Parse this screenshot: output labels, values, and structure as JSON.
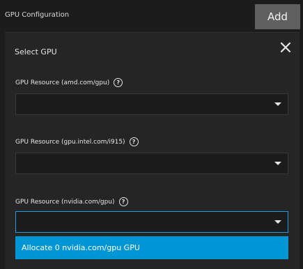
{
  "topbar": {
    "title": "GPU Configuration",
    "add_label": "Add"
  },
  "panel": {
    "title": "Select GPU"
  },
  "fields": [
    {
      "label": "GPU Resource (amd.com/gpu)",
      "help": "?",
      "value": ""
    },
    {
      "label": "GPU Resource (gpu.intel.com/i915)",
      "help": "?",
      "value": ""
    },
    {
      "label": "GPU Resource (nvidia.com/gpu)",
      "help": "?",
      "value": ""
    }
  ],
  "dropdown": {
    "options": [
      "Allocate 0 nvidia.com/gpu GPU"
    ]
  },
  "colors": {
    "accent": "#0095d5",
    "focus_border": "#1e9ce4",
    "background": "#1c1c1c",
    "panel": "#252525",
    "button": "#5f5f5f"
  },
  "icons": {
    "close": "close-icon",
    "help": "help-icon",
    "dropdown": "chevron-down-icon"
  }
}
